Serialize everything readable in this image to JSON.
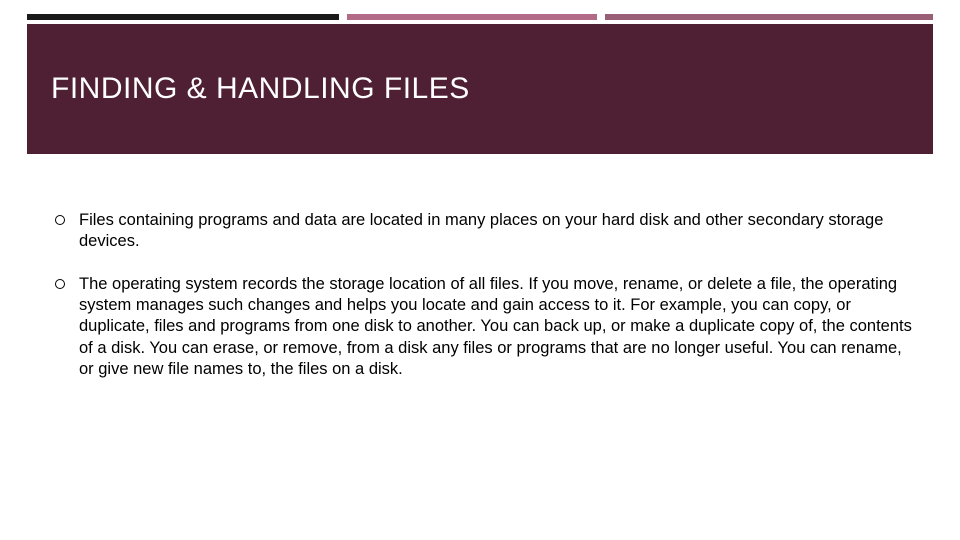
{
  "title": "FINDING & HANDLING FILES",
  "bullets": [
    "Files containing programs and data are located in many places on your hard disk and other secondary storage devices.",
    "The operating system records the storage location of all files. If you move, rename, or delete a file, the operating system manages such changes and helps you locate and gain access to it. For example, you can  copy,  or duplicate, files and programs from one disk to another. You can  back up,  or make a duplicate copy of, the contents of a disk. You can  erase,  or remove, from a disk any files or programs that are no longer useful. You can  rename,  or give new file names to, the files on a disk."
  ],
  "colors": {
    "title_bg": "#4f1f34",
    "accent_dark": "#1a1a1a",
    "accent_mid": "#b36a87",
    "accent_light": "#995f76"
  }
}
